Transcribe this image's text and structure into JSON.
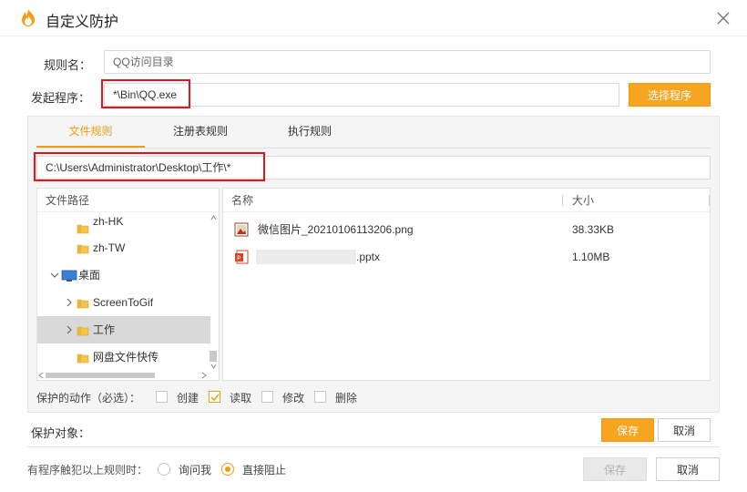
{
  "window": {
    "title": "自定义防护"
  },
  "form": {
    "rule_name_label": "规则名：",
    "rule_name_value": "QQ访问目录",
    "program_label": "发起程序：",
    "program_value": "*\\Bin\\QQ.exe",
    "select_program_button": "选择程序"
  },
  "tabs": [
    {
      "label": "文件规则",
      "active": true
    },
    {
      "label": "注册表规则",
      "active": false
    },
    {
      "label": "执行规则",
      "active": false
    }
  ],
  "path_value": "C:\\Users\\Administrator\\Desktop\\工作\\*",
  "tree": {
    "header": "文件路径",
    "items": [
      {
        "label": "zh-HK",
        "icon": "folder-icon"
      },
      {
        "label": "zh-TW",
        "icon": "folder-icon"
      },
      {
        "label": "桌面",
        "icon": "desktop-icon",
        "expanded": true
      },
      {
        "label": "ScreenToGif",
        "icon": "folder-icon"
      },
      {
        "label": "工作",
        "icon": "folder-icon",
        "selected": true
      },
      {
        "label": "网盘文件快传",
        "icon": "folder-icon"
      }
    ]
  },
  "file_list": {
    "col_name": "名称",
    "col_size": "大小",
    "rows": [
      {
        "name": "微信图片_20210106113206.png",
        "size": "38.33KB",
        "icon": "image-file-icon"
      },
      {
        "name": ".pptx",
        "size": "1.10MB",
        "icon": "powerpoint-file-icon"
      }
    ]
  },
  "actions": {
    "label": "保护的动作（必选）：",
    "items": [
      {
        "label": "创建",
        "checked": false
      },
      {
        "label": "读取",
        "checked": true
      },
      {
        "label": "修改",
        "checked": false
      },
      {
        "label": "删除",
        "checked": false
      }
    ]
  },
  "protect_target": {
    "label": "保护对象：",
    "save": "保存",
    "cancel": "取消"
  },
  "footer": {
    "label": "有程序触犯以上规则时：",
    "options": [
      {
        "label": "询问我",
        "selected": false
      },
      {
        "label": "直接阻止",
        "selected": true
      }
    ],
    "save": "保存",
    "cancel": "取消"
  },
  "colors": {
    "accent": "#f39c12",
    "highlight": "#e2141c"
  }
}
